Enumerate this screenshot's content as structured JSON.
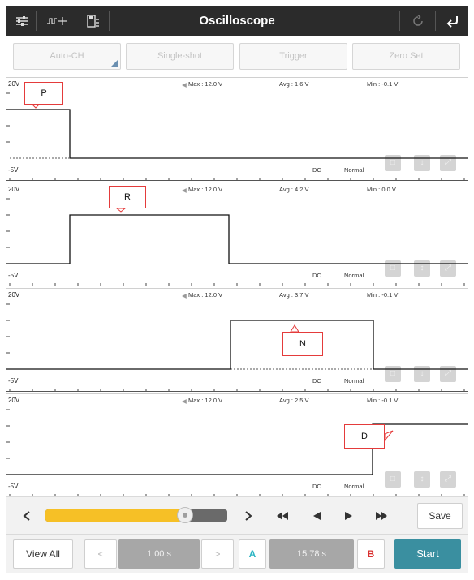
{
  "header": {
    "title": "Oscilloscope",
    "icons": [
      "sliders-icon",
      "waveform-settings-icon",
      "save-file-icon",
      "refresh-icon",
      "back-icon"
    ]
  },
  "function_buttons": [
    "Auto-CH",
    "Single-shot",
    "Trigger",
    "Zero Set"
  ],
  "channels": [
    {
      "top_label": "20V",
      "bottom_label": "-5V",
      "max": "Max : 12.0 V",
      "avg": "Avg : 1.6 V",
      "min": "Min : -0.1 V",
      "coupling": "DC",
      "mode": "Normal",
      "gear": "P"
    },
    {
      "top_label": "20V",
      "bottom_label": "-5V",
      "max": "Max : 12.0 V",
      "avg": "Avg : 4.2 V",
      "min": "Min : 0.0 V",
      "coupling": "DC",
      "mode": "Normal",
      "gear": "R"
    },
    {
      "top_label": "20V",
      "bottom_label": "-5V",
      "max": "Max : 12.0 V",
      "avg": "Avg : 3.7 V",
      "min": "Min : -0.1 V",
      "coupling": "DC",
      "mode": "Normal",
      "gear": "N"
    },
    {
      "top_label": "20V",
      "bottom_label": "-5V",
      "max": "Max : 12.0 V",
      "avg": "Avg : 2.5 V",
      "min": "Min : -0.1 V",
      "coupling": "DC",
      "mode": "Normal",
      "gear": "D"
    }
  ],
  "slider": {
    "position_fraction": 0.77
  },
  "controls": {
    "save_label": "Save"
  },
  "bottom": {
    "view_all": "View All",
    "prev": "<",
    "time_base": "1.00 s",
    "next": ">",
    "a_label": "A",
    "cursor_delta": "15.78 s",
    "b_label": "B",
    "start": "Start"
  },
  "colors": {
    "header_bg": "#2b2b2b",
    "accent_a": "#2fb6c4",
    "accent_b": "#d9302f",
    "slider_fill": "#f6c026",
    "start_bg": "#3a8fa0",
    "callout_border": "#e43b3b"
  }
}
